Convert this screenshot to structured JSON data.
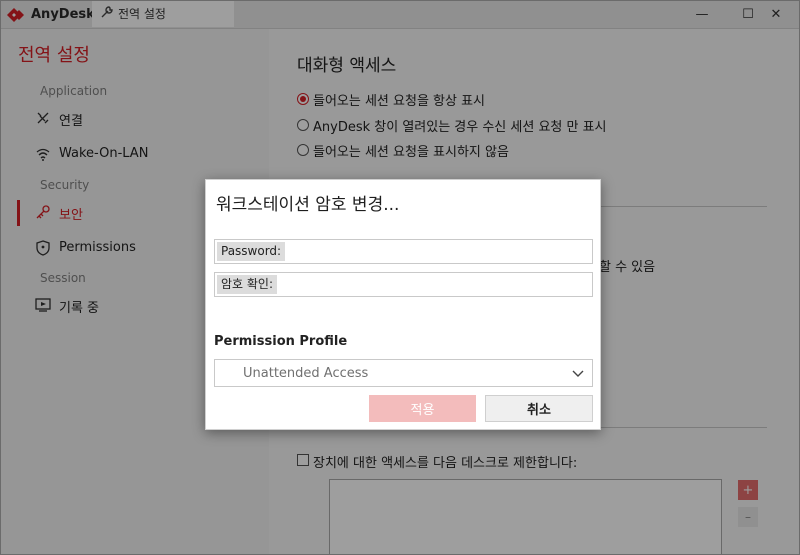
{
  "app": {
    "title": "AnyDesk",
    "brand_color": "#d51f26"
  },
  "tab": {
    "icon": "wrench-icon",
    "label": "전역 설정"
  },
  "window_controls": {
    "minimize": "—",
    "maximize": "☐",
    "close": "✕"
  },
  "sidebar": {
    "title": "전역 설정",
    "sections": [
      {
        "label": "Application"
      },
      {
        "label": "Security"
      },
      {
        "label": "Session"
      }
    ],
    "items": [
      {
        "icon": "connection-icon",
        "label": "연결"
      },
      {
        "icon": "wifi-icon",
        "label": "Wake-On-LAN"
      },
      {
        "icon": "key-icon",
        "label": "보안",
        "active": true
      },
      {
        "icon": "shield-icon",
        "label": "Permissions"
      },
      {
        "icon": "record-icon",
        "label": "기록 중"
      }
    ]
  },
  "main": {
    "title": "대화형 액세스",
    "radios": [
      {
        "label": "들어오는 세션 요청을 항상 표시",
        "selected": true
      },
      {
        "label": "AnyDesk 창이 열려있는 경우 수신 세션 요청 만 표시",
        "selected": false
      },
      {
        "label": "들어오는 세션 요청을 표시하지 않음",
        "selected": false
      }
    ],
    "partial_text": "할 수 있음",
    "restrict_checkbox": {
      "label": "장치에 대한 액세스를 다음 데스크로 제한합니다:",
      "checked": false
    },
    "plus_label": "+",
    "minus_label": "–"
  },
  "dialog": {
    "title": "워크스테이션 암호 변경...",
    "password_label": "Password:",
    "confirm_label": "암호 확인:",
    "password_value": "",
    "confirm_value": "",
    "profile_label": "Permission Profile",
    "profile_value": "Unattended Access",
    "apply_label": "적용",
    "cancel_label": "취소"
  }
}
